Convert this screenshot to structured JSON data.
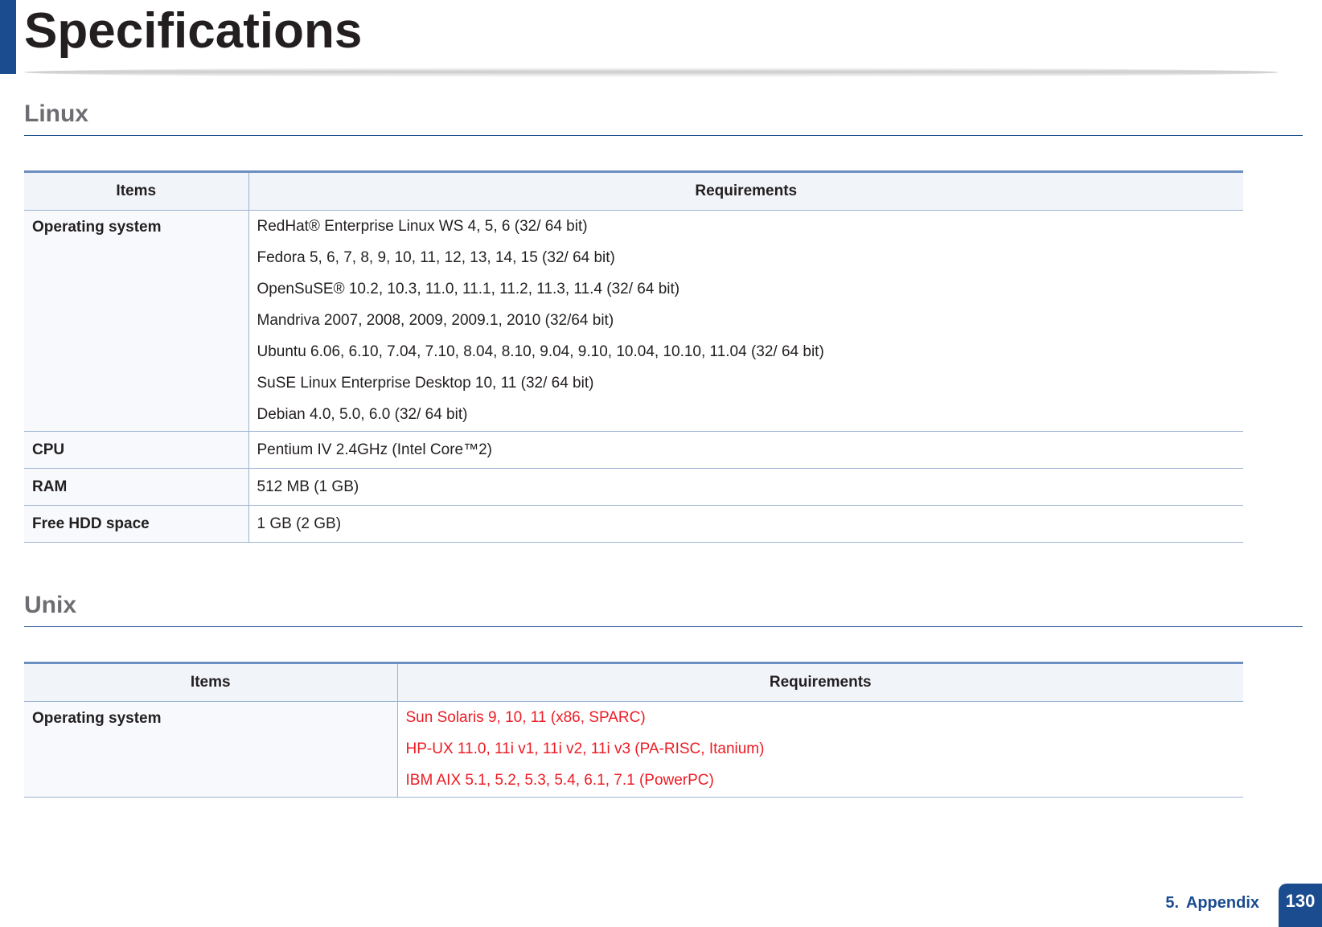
{
  "page": {
    "title": "Specifications",
    "footer_label": "5.  Appendix",
    "page_number": "130"
  },
  "linux": {
    "heading": "Linux",
    "headers": {
      "items": "Items",
      "requirements": "Requirements"
    },
    "rows": [
      {
        "item": "Operating system",
        "values": [
          "RedHat® Enterprise Linux WS 4, 5, 6 (32/ 64 bit)",
          "Fedora 5, 6, 7, 8, 9, 10, 11, 12, 13, 14, 15 (32/ 64 bit)",
          "OpenSuSE® 10.2, 10.3, 11.0, 11.1, 11.2, 11.3, 11.4 (32/ 64 bit)",
          "Mandriva 2007, 2008, 2009, 2009.1, 2010 (32/64 bit)",
          "Ubuntu 6.06, 6.10, 7.04, 7.10, 8.04, 8.10, 9.04, 9.10, 10.04, 10.10, 11.04 (32/ 64 bit)",
          "SuSE Linux Enterprise Desktop 10, 11 (32/ 64 bit)",
          "Debian 4.0, 5.0, 6.0 (32/ 64 bit)"
        ]
      },
      {
        "item": "CPU",
        "values": [
          "Pentium IV 2.4GHz (Intel Core™2)"
        ]
      },
      {
        "item": "RAM",
        "values": [
          "512 MB (1 GB)"
        ]
      },
      {
        "item": "Free HDD space",
        "values": [
          "1 GB (2 GB)"
        ]
      }
    ]
  },
  "unix": {
    "heading": "Unix",
    "headers": {
      "items": "Items",
      "requirements": "Requirements"
    },
    "rows": [
      {
        "item": "Operating system",
        "values": [
          "Sun Solaris 9, 10, 11 (x86, SPARC)",
          "HP-UX 11.0, 11i v1, 11i v2, 11i v3 (PA-RISC, Itanium)",
          "IBM AIX 5.1, 5.2, 5.3, 5.4, 6.1, 7.1 (PowerPC)"
        ]
      }
    ]
  },
  "colors": {
    "brand_blue": "#1b4c8f",
    "highlight_red": "#ec1c24",
    "heading_gray": "#6d6e71"
  }
}
